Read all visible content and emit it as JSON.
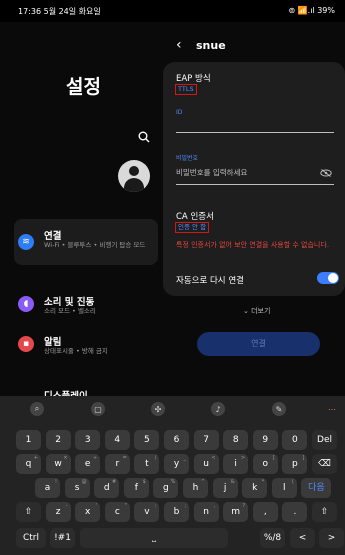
{
  "status": {
    "time_date": "17:36  5월 24일 화요일",
    "right": "⊚ 📶.ıl 39%"
  },
  "settings": {
    "title": "설정",
    "menu": [
      {
        "title": "연결",
        "sub": "Wi-Fi • 블루투스 • 비행기 탑승 모드",
        "color": "#2e7cf6",
        "icon": "wifi-icon"
      },
      {
        "title": "소리 및 진동",
        "sub": "소리 모드 • 벨소리",
        "color": "#8a5cf6",
        "icon": "sound-icon"
      },
      {
        "title": "알림",
        "sub": "상태표시줄 • 방해 금지",
        "color": "#e5484d",
        "icon": "bell-icon"
      },
      {
        "title": "디스플레이",
        "sub": "",
        "color": "#2ea84d",
        "icon": "display-icon"
      }
    ]
  },
  "panel": {
    "network": "snue",
    "eap_label": "EAP 방식",
    "eap_value": "TTLS",
    "id_label": "ID",
    "password_label": "비밀번호",
    "password_placeholder": "비밀번호를 입력하세요",
    "ca_label": "CA 인증서",
    "ca_value": "인증 안 함",
    "warning": "특정 인증서가 없어 보안 연결을 사용할 수 없습니다.",
    "auto_reconnect": "자동으로 다시 연결",
    "auto_reconnect_on": true,
    "more": "더보기",
    "connect": "연결"
  },
  "keyboard": {
    "toolbar": [
      "search-icon",
      "clipboard-icon",
      "move-icon",
      "mic-icon",
      "handwriting-icon",
      "more-icon"
    ],
    "row1": [
      "1",
      "2",
      "3",
      "4",
      "5",
      "6",
      "7",
      "8",
      "9",
      "0",
      "Del"
    ],
    "row2": [
      [
        "q",
        "+"
      ],
      [
        "w",
        "×"
      ],
      [
        "e",
        "÷"
      ],
      [
        "r",
        "="
      ],
      [
        "t",
        "/"
      ],
      [
        "y",
        "_"
      ],
      [
        "u",
        "<"
      ],
      [
        "i",
        ">"
      ],
      [
        "o",
        "["
      ],
      [
        "p",
        "]"
      ],
      [
        "⌫",
        ""
      ]
    ],
    "row3": [
      [
        "a",
        "!"
      ],
      [
        "s",
        "@"
      ],
      [
        "d",
        "#"
      ],
      [
        "f",
        "$"
      ],
      [
        "g",
        "%"
      ],
      [
        "h",
        "^"
      ],
      [
        "j",
        "&"
      ],
      [
        "k",
        "*"
      ],
      [
        "l",
        "("
      ],
      [
        "다음",
        ""
      ]
    ],
    "row4": [
      [
        "⇧",
        ""
      ],
      [
        "z",
        "-"
      ],
      [
        "x",
        "'"
      ],
      [
        "c",
        "\""
      ],
      [
        "v",
        ":"
      ],
      [
        "b",
        ";"
      ],
      [
        "n",
        ","
      ],
      [
        "m",
        "?"
      ],
      [
        ",",
        ""
      ],
      [
        ".",
        ""
      ],
      [
        "⇧",
        ""
      ]
    ],
    "row5": [
      "Ctrl",
      "!#1",
      "space",
      "%/8",
      "<",
      ">"
    ]
  }
}
